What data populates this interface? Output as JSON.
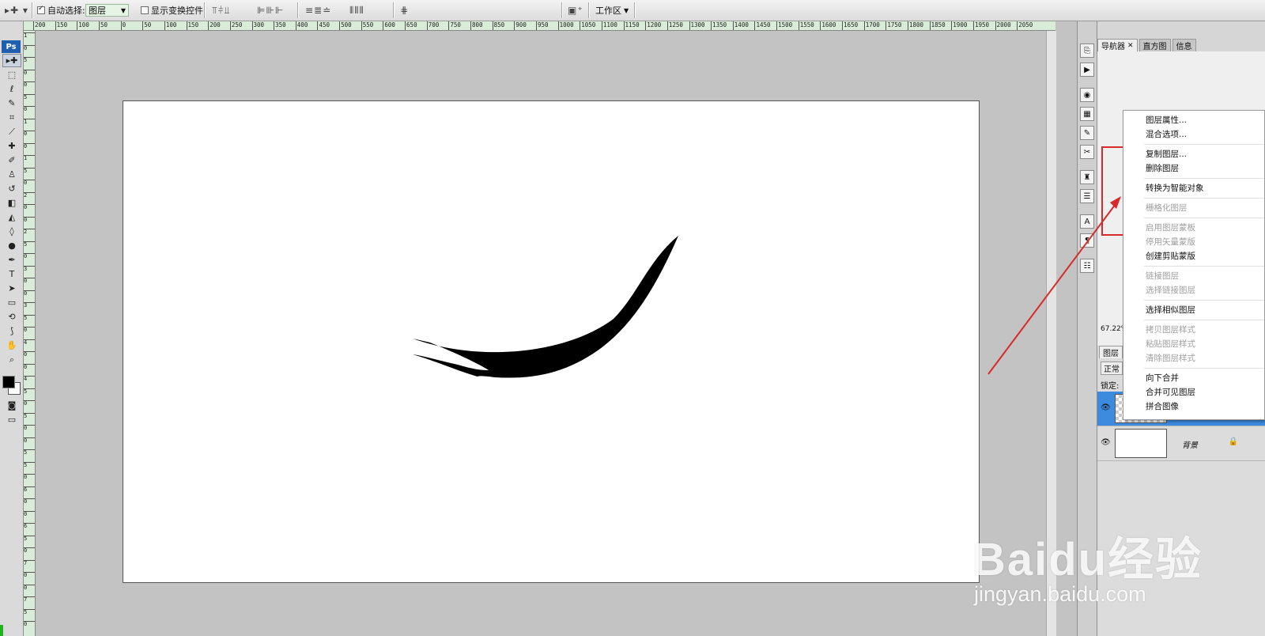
{
  "options_bar": {
    "move_tool_icon": "move-arrow-icon",
    "auto_select_label": "自动选择:",
    "auto_select_checked": true,
    "auto_select_value": "图层",
    "show_transform_label": "显示变换控件",
    "show_transform_checked": false,
    "workspace_label": "工作区"
  },
  "tools_panel": {
    "logo": "Ps",
    "tools": [
      {
        "name": "move-tool",
        "icon": "▸✚"
      },
      {
        "name": "marquee-tool",
        "icon": "⬚"
      },
      {
        "name": "lasso-tool",
        "icon": "ℓ"
      },
      {
        "name": "quick-select-tool",
        "icon": "✎"
      },
      {
        "name": "crop-tool",
        "icon": "⌗"
      },
      {
        "name": "slice-tool",
        "icon": "⟋"
      },
      {
        "name": "healing-tool",
        "icon": "✚"
      },
      {
        "name": "brush-tool",
        "icon": "✐"
      },
      {
        "name": "stamp-tool",
        "icon": "♙"
      },
      {
        "name": "history-brush-tool",
        "icon": "↺"
      },
      {
        "name": "eraser-tool",
        "icon": "◧"
      },
      {
        "name": "paint-bucket-tool",
        "icon": "◭"
      },
      {
        "name": "blur-tool",
        "icon": "◊"
      },
      {
        "name": "dodge-tool",
        "icon": "●"
      },
      {
        "name": "pen-tool",
        "icon": "✒"
      },
      {
        "name": "type-tool",
        "icon": "T"
      },
      {
        "name": "path-select-tool",
        "icon": "➤"
      },
      {
        "name": "shape-tool",
        "icon": "▭"
      },
      {
        "name": "3d-tool",
        "icon": "⟲"
      },
      {
        "name": "eyedropper-tool",
        "icon": "⟆"
      },
      {
        "name": "hand-tool",
        "icon": "✋"
      },
      {
        "name": "zoom-tool",
        "icon": "⌕"
      }
    ],
    "foreground_color": "#000000",
    "background_color": "#ffffff"
  },
  "ruler_top_labels": [
    "200",
    "150",
    "100",
    "50",
    "0",
    "50",
    "100",
    "150",
    "200",
    "250",
    "300",
    "350",
    "400",
    "450",
    "500",
    "550",
    "600",
    "650",
    "700",
    "750",
    "800",
    "850",
    "900",
    "950",
    "1000",
    "1050",
    "1100",
    "1150",
    "1200",
    "1250",
    "1300",
    "1350",
    "1400",
    "1450",
    "1500",
    "1550",
    "1600",
    "1650",
    "1700",
    "1750",
    "1800",
    "1850",
    "1900",
    "1950",
    "2000",
    "2050"
  ],
  "ruler_left_labels": [
    "1",
    "0",
    "5",
    "0",
    "0",
    "5",
    "0",
    "1",
    "0",
    "0",
    "1",
    "5",
    "0",
    "2",
    "0",
    "0",
    "2",
    "5",
    "0",
    "3",
    "0",
    "0",
    "3",
    "5",
    "0",
    "4",
    "0",
    "0",
    "4",
    "5",
    "0",
    "5",
    "0",
    "0",
    "5",
    "5",
    "0",
    "6",
    "0",
    "0",
    "6",
    "5",
    "0",
    "7",
    "0",
    "0",
    "7",
    "5",
    "0"
  ],
  "right_panel": {
    "tabs": [
      {
        "label": "导航器",
        "selected": true
      },
      {
        "label": "直方图",
        "selected": false
      },
      {
        "label": "信息",
        "selected": false
      }
    ],
    "zoom_value": "67.22%",
    "layers_tab": "图层",
    "blend_mode": "正常",
    "lock_label": "锁定:",
    "layers": [
      {
        "name": "",
        "type": "transparent",
        "selected": true
      },
      {
        "name": "背景",
        "type": "background",
        "locked": true
      }
    ]
  },
  "context_menu": {
    "groups": [
      [
        {
          "label": "图层属性...",
          "enabled": true
        },
        {
          "label": "混合选项...",
          "enabled": true
        }
      ],
      [
        {
          "label": "复制图层...",
          "enabled": true
        },
        {
          "label": "删除图层",
          "enabled": true
        }
      ],
      [
        {
          "label": "转换为智能对象",
          "enabled": true
        }
      ],
      [
        {
          "label": "栅格化图层",
          "enabled": false
        }
      ],
      [
        {
          "label": "启用图层蒙板",
          "enabled": false
        },
        {
          "label": "停用矢量蒙版",
          "enabled": false
        },
        {
          "label": "创建剪贴蒙版",
          "enabled": true
        }
      ],
      [
        {
          "label": "链接图层",
          "enabled": false
        },
        {
          "label": "选择链接图层",
          "enabled": false
        }
      ],
      [
        {
          "label": "选择相似图层",
          "enabled": true
        }
      ],
      [
        {
          "label": "拷贝图层样式",
          "enabled": false
        },
        {
          "label": "粘贴图层样式",
          "enabled": false
        },
        {
          "label": "清除图层样式",
          "enabled": false
        }
      ],
      [
        {
          "label": "向下合并",
          "enabled": true
        },
        {
          "label": "合并可见图层",
          "enabled": true
        },
        {
          "label": "拼合图像",
          "enabled": true
        }
      ]
    ]
  },
  "annotation": {
    "color": "#d82a2a"
  },
  "watermark": {
    "logo": "Baidu经验",
    "site": "jingyan.baidu.com"
  }
}
